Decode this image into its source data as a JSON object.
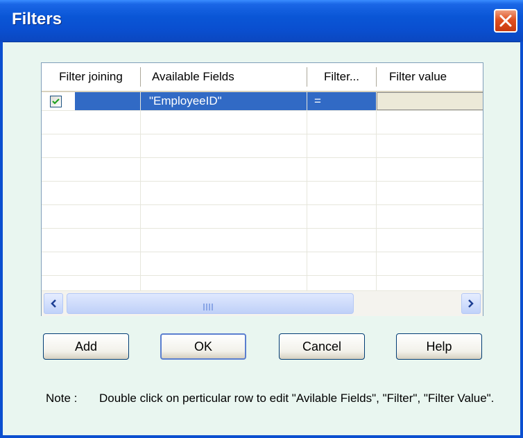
{
  "window": {
    "title": "Filters"
  },
  "grid": {
    "columns": [
      "Filter joining",
      "Available Fields",
      "Filter...",
      "Filter value"
    ],
    "rows": [
      {
        "checked": true,
        "field": "\"EmployeeID\"",
        "filter": "=",
        "value": ""
      }
    ]
  },
  "buttons": {
    "add": "Add",
    "ok": "OK",
    "cancel": "Cancel",
    "help": "Help"
  },
  "note": {
    "label": "Note :",
    "text": "Double click on perticular row to edit \"Avilable Fields\", \"Filter\", \"Filter Value\"."
  },
  "colors": {
    "title_bar": "#0a56d6",
    "selection": "#316ac5",
    "dialog_bg": "#e9f6f0"
  }
}
